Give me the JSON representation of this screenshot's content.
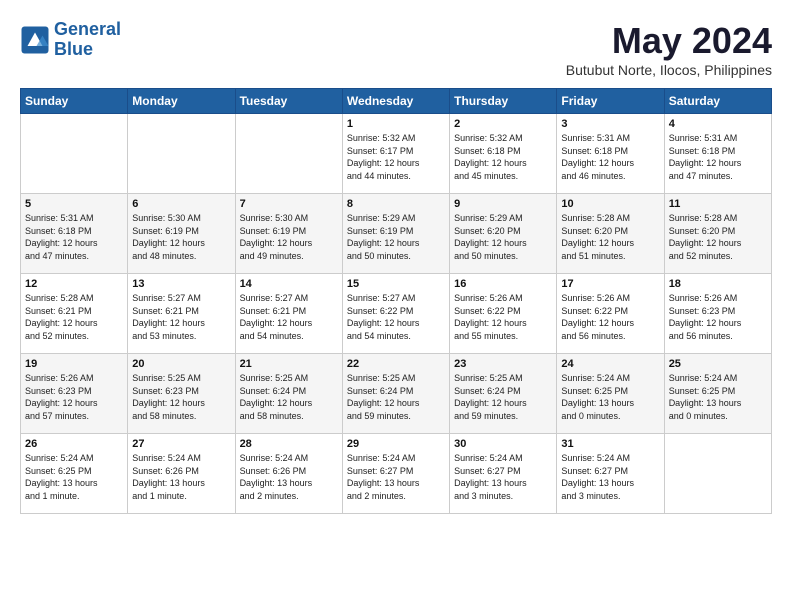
{
  "header": {
    "logo_line1": "General",
    "logo_line2": "Blue",
    "month_year": "May 2024",
    "location": "Butubut Norte, Ilocos, Philippines"
  },
  "days_of_week": [
    "Sunday",
    "Monday",
    "Tuesday",
    "Wednesday",
    "Thursday",
    "Friday",
    "Saturday"
  ],
  "weeks": [
    [
      {
        "day": "",
        "info": ""
      },
      {
        "day": "",
        "info": ""
      },
      {
        "day": "",
        "info": ""
      },
      {
        "day": "1",
        "info": "Sunrise: 5:32 AM\nSunset: 6:17 PM\nDaylight: 12 hours\nand 44 minutes."
      },
      {
        "day": "2",
        "info": "Sunrise: 5:32 AM\nSunset: 6:18 PM\nDaylight: 12 hours\nand 45 minutes."
      },
      {
        "day": "3",
        "info": "Sunrise: 5:31 AM\nSunset: 6:18 PM\nDaylight: 12 hours\nand 46 minutes."
      },
      {
        "day": "4",
        "info": "Sunrise: 5:31 AM\nSunset: 6:18 PM\nDaylight: 12 hours\nand 47 minutes."
      }
    ],
    [
      {
        "day": "5",
        "info": "Sunrise: 5:31 AM\nSunset: 6:18 PM\nDaylight: 12 hours\nand 47 minutes."
      },
      {
        "day": "6",
        "info": "Sunrise: 5:30 AM\nSunset: 6:19 PM\nDaylight: 12 hours\nand 48 minutes."
      },
      {
        "day": "7",
        "info": "Sunrise: 5:30 AM\nSunset: 6:19 PM\nDaylight: 12 hours\nand 49 minutes."
      },
      {
        "day": "8",
        "info": "Sunrise: 5:29 AM\nSunset: 6:19 PM\nDaylight: 12 hours\nand 50 minutes."
      },
      {
        "day": "9",
        "info": "Sunrise: 5:29 AM\nSunset: 6:20 PM\nDaylight: 12 hours\nand 50 minutes."
      },
      {
        "day": "10",
        "info": "Sunrise: 5:28 AM\nSunset: 6:20 PM\nDaylight: 12 hours\nand 51 minutes."
      },
      {
        "day": "11",
        "info": "Sunrise: 5:28 AM\nSunset: 6:20 PM\nDaylight: 12 hours\nand 52 minutes."
      }
    ],
    [
      {
        "day": "12",
        "info": "Sunrise: 5:28 AM\nSunset: 6:21 PM\nDaylight: 12 hours\nand 52 minutes."
      },
      {
        "day": "13",
        "info": "Sunrise: 5:27 AM\nSunset: 6:21 PM\nDaylight: 12 hours\nand 53 minutes."
      },
      {
        "day": "14",
        "info": "Sunrise: 5:27 AM\nSunset: 6:21 PM\nDaylight: 12 hours\nand 54 minutes."
      },
      {
        "day": "15",
        "info": "Sunrise: 5:27 AM\nSunset: 6:22 PM\nDaylight: 12 hours\nand 54 minutes."
      },
      {
        "day": "16",
        "info": "Sunrise: 5:26 AM\nSunset: 6:22 PM\nDaylight: 12 hours\nand 55 minutes."
      },
      {
        "day": "17",
        "info": "Sunrise: 5:26 AM\nSunset: 6:22 PM\nDaylight: 12 hours\nand 56 minutes."
      },
      {
        "day": "18",
        "info": "Sunrise: 5:26 AM\nSunset: 6:23 PM\nDaylight: 12 hours\nand 56 minutes."
      }
    ],
    [
      {
        "day": "19",
        "info": "Sunrise: 5:26 AM\nSunset: 6:23 PM\nDaylight: 12 hours\nand 57 minutes."
      },
      {
        "day": "20",
        "info": "Sunrise: 5:25 AM\nSunset: 6:23 PM\nDaylight: 12 hours\nand 58 minutes."
      },
      {
        "day": "21",
        "info": "Sunrise: 5:25 AM\nSunset: 6:24 PM\nDaylight: 12 hours\nand 58 minutes."
      },
      {
        "day": "22",
        "info": "Sunrise: 5:25 AM\nSunset: 6:24 PM\nDaylight: 12 hours\nand 59 minutes."
      },
      {
        "day": "23",
        "info": "Sunrise: 5:25 AM\nSunset: 6:24 PM\nDaylight: 12 hours\nand 59 minutes."
      },
      {
        "day": "24",
        "info": "Sunrise: 5:24 AM\nSunset: 6:25 PM\nDaylight: 13 hours\nand 0 minutes."
      },
      {
        "day": "25",
        "info": "Sunrise: 5:24 AM\nSunset: 6:25 PM\nDaylight: 13 hours\nand 0 minutes."
      }
    ],
    [
      {
        "day": "26",
        "info": "Sunrise: 5:24 AM\nSunset: 6:25 PM\nDaylight: 13 hours\nand 1 minute."
      },
      {
        "day": "27",
        "info": "Sunrise: 5:24 AM\nSunset: 6:26 PM\nDaylight: 13 hours\nand 1 minute."
      },
      {
        "day": "28",
        "info": "Sunrise: 5:24 AM\nSunset: 6:26 PM\nDaylight: 13 hours\nand 2 minutes."
      },
      {
        "day": "29",
        "info": "Sunrise: 5:24 AM\nSunset: 6:27 PM\nDaylight: 13 hours\nand 2 minutes."
      },
      {
        "day": "30",
        "info": "Sunrise: 5:24 AM\nSunset: 6:27 PM\nDaylight: 13 hours\nand 3 minutes."
      },
      {
        "day": "31",
        "info": "Sunrise: 5:24 AM\nSunset: 6:27 PM\nDaylight: 13 hours\nand 3 minutes."
      },
      {
        "day": "",
        "info": ""
      }
    ]
  ]
}
